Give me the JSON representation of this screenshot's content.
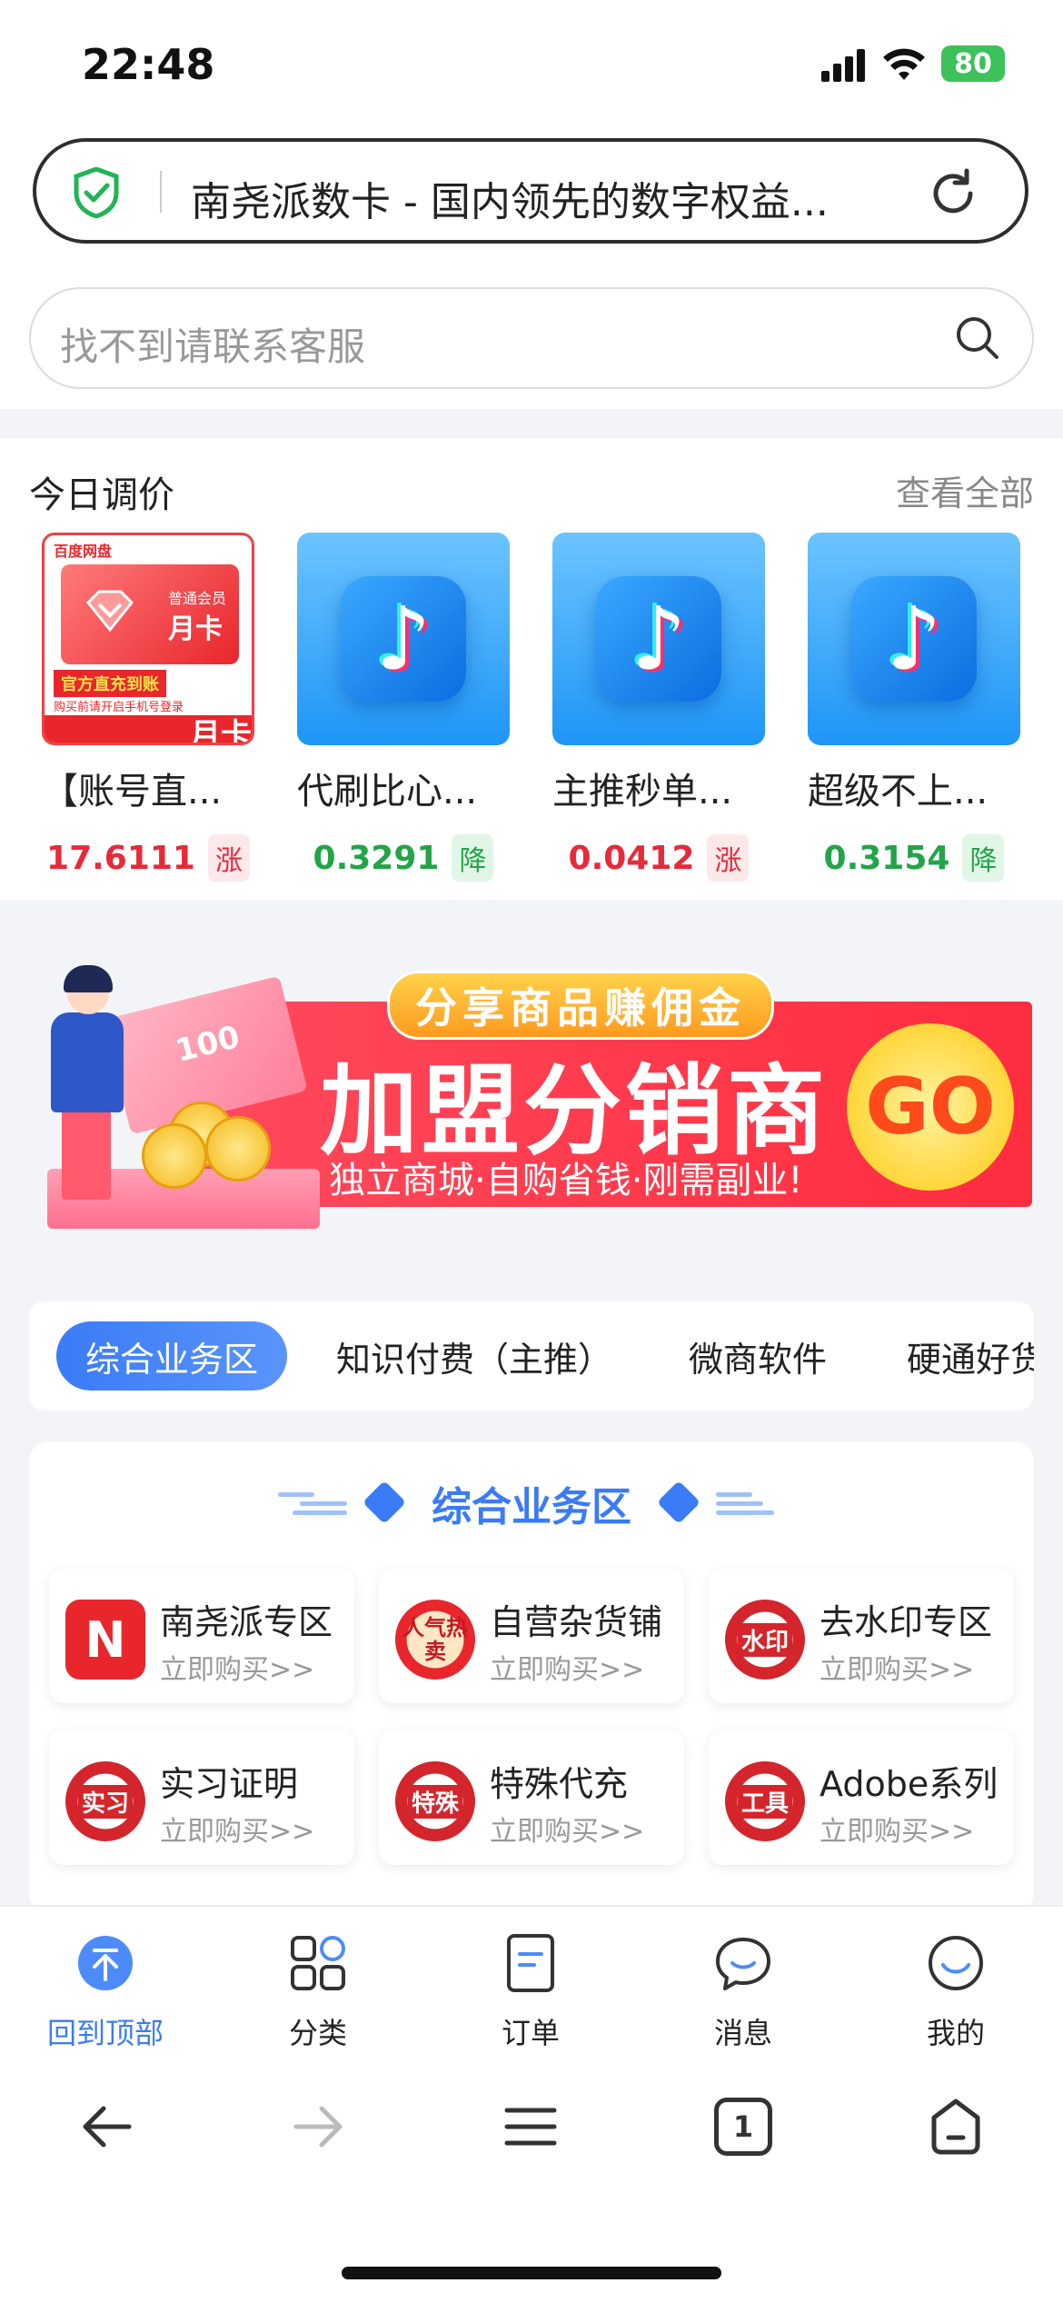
{
  "status": {
    "time": "22:48",
    "battery": "80"
  },
  "browser": {
    "page_title": "南尧派数卡 - 国内领先的数字权益...",
    "security_icon": "shield-check-icon",
    "reload_icon": "reload-icon"
  },
  "search": {
    "placeholder": "找不到请联系客服"
  },
  "today_prices": {
    "title": "今日调价",
    "view_all": "查看全部",
    "items": [
      {
        "name": "【账号直...",
        "price": "17.6111",
        "trend": "涨",
        "direction": "up"
      },
      {
        "name": "代刷比心...",
        "price": "0.3291",
        "trend": "降",
        "direction": "down"
      },
      {
        "name": "主推秒单...",
        "price": "0.0412",
        "trend": "涨",
        "direction": "up"
      },
      {
        "name": "超级不上...",
        "price": "0.3154",
        "trend": "降",
        "direction": "down"
      }
    ],
    "baidu_card": {
      "brand": "百度网盘",
      "type": "普通会员",
      "label": "月卡",
      "ribbon": "官方直充到账",
      "note": "购买前请开启手机号登录",
      "bottom_label": "月卡"
    },
    "tiktok_glyph": "♪"
  },
  "banner": {
    "top_pill": "分享商品赚佣金",
    "title": "加盟分销商",
    "subtitle": "独立商城·自购省钱·刚需副业!",
    "button": "GO",
    "money_label": "100"
  },
  "tabs": [
    "综合业务区",
    "知识付费（主推）",
    "微商软件",
    "硬通好货"
  ],
  "services": {
    "title": "综合业务区",
    "items": [
      {
        "name": "南尧派专区",
        "link": "立即购买>>",
        "icon": "N"
      },
      {
        "name": "自营杂货铺",
        "link": "立即购买>>",
        "icon": "人气热卖"
      },
      {
        "name": "去水印专区",
        "link": "立即购买>>",
        "icon": "水印"
      },
      {
        "name": "实习证明",
        "link": "立即购买>>",
        "icon": "实习"
      },
      {
        "name": "特殊代充",
        "link": "立即购买>>",
        "icon": "特殊"
      },
      {
        "name": "Adobe系列",
        "link": "立即购买>>",
        "icon": "工具"
      }
    ]
  },
  "bottom_nav": [
    {
      "label": "回到顶部",
      "icon": "back-to-top-icon"
    },
    {
      "label": "分类",
      "icon": "category-icon"
    },
    {
      "label": "订单",
      "icon": "order-icon"
    },
    {
      "label": "消息",
      "icon": "message-icon"
    },
    {
      "label": "我的",
      "icon": "profile-icon"
    }
  ],
  "browser_toolbar": {
    "tab_count": "1"
  },
  "colors": {
    "accent": "#3a7bf7",
    "up": "#e8293a",
    "down": "#22a447"
  }
}
